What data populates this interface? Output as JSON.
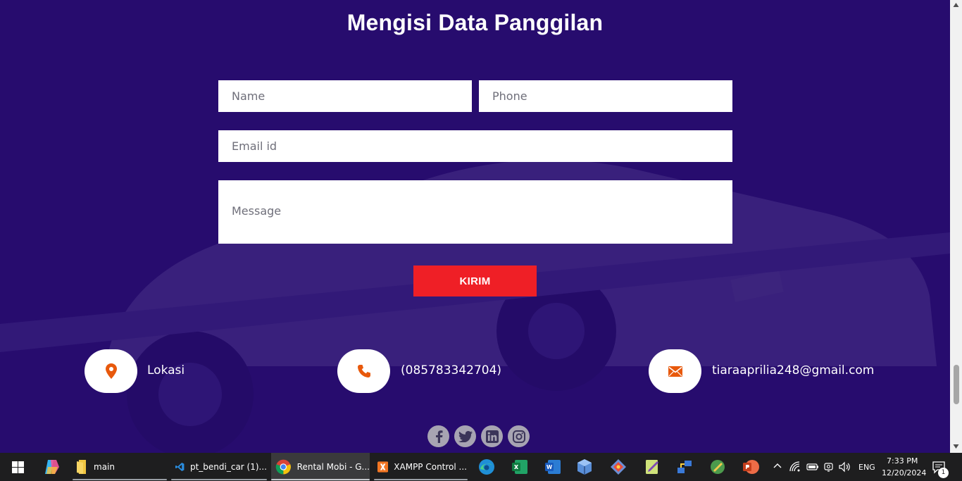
{
  "page": {
    "heading": "Mengisi Data Panggilan",
    "form": {
      "name_placeholder": "Name",
      "phone_placeholder": "Phone",
      "email_placeholder": "Email id",
      "message_placeholder": "Message",
      "submit_label": "KIRIM"
    },
    "contacts": {
      "location": "Lokasi",
      "phone": "(085783342704)",
      "email": "tiaraaprilia248@gmail.com"
    },
    "social": [
      "facebook-icon",
      "twitter-icon",
      "linkedin-icon",
      "instagram-icon"
    ],
    "colors": {
      "background": "#270c6e",
      "button": "#ef1f26",
      "contact_icon": "#e8590c",
      "social_circle": "#a7a4b2"
    }
  },
  "taskbar": {
    "apps": [
      {
        "label": "main",
        "icon": "folder-icon"
      },
      {
        "label": "pt_bendi_car (1)...",
        "icon": "vscode-icon"
      },
      {
        "label": "Rental Mobi - G...",
        "icon": "chrome-icon"
      },
      {
        "label": "XAMPP Control ...",
        "icon": "xampp-icon"
      }
    ],
    "tray": {
      "language": "ENG",
      "time": "7:33 PM",
      "date": "12/20/2024",
      "notification_count": "1"
    }
  }
}
